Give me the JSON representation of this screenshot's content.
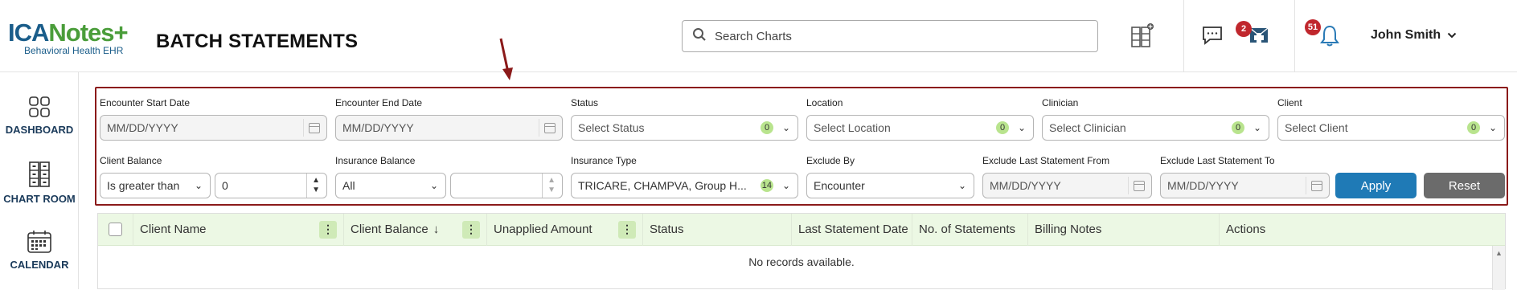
{
  "app": {
    "logo_main": "ICA",
    "logo_notes": "Notes",
    "logo_plus": "+",
    "logo_sub": "Behavioral Health EHR",
    "page_title": "BATCH STATEMENTS"
  },
  "header": {
    "search_placeholder": "Search Charts",
    "messages_badge": "2",
    "notifications_badge": "51",
    "user_name": "John Smith"
  },
  "sidebar": {
    "items": [
      {
        "label": "DASHBOARD",
        "icon": "dashboard-icon"
      },
      {
        "label": "CHART ROOM",
        "icon": "chart-room-icon"
      },
      {
        "label": "CALENDAR",
        "icon": "calendar-icon"
      }
    ]
  },
  "filters": {
    "encounter_start": {
      "label": "Encounter Start Date",
      "placeholder": "MM/DD/YYYY"
    },
    "encounter_end": {
      "label": "Encounter End Date",
      "placeholder": "MM/DD/YYYY"
    },
    "status": {
      "label": "Status",
      "placeholder": "Select Status",
      "count": "0"
    },
    "location": {
      "label": "Location",
      "placeholder": "Select Location",
      "count": "0"
    },
    "clinician": {
      "label": "Clinician",
      "placeholder": "Select Clinician",
      "count": "0"
    },
    "client": {
      "label": "Client",
      "placeholder": "Select Client",
      "count": "0"
    },
    "client_balance": {
      "label": "Client Balance",
      "operator": "Is greater than",
      "value": "0"
    },
    "insurance_balance": {
      "label": "Insurance Balance",
      "value": "All",
      "amount": ""
    },
    "insurance_type": {
      "label": "Insurance Type",
      "value": "TRICARE, CHAMPVA, Group H...",
      "count": "14"
    },
    "exclude_by": {
      "label": "Exclude By",
      "value": "Encounter"
    },
    "exclude_from": {
      "label": "Exclude Last Statement From",
      "placeholder": "MM/DD/YYYY"
    },
    "exclude_to": {
      "label": "Exclude Last Statement To",
      "placeholder": "MM/DD/YYYY"
    },
    "apply_label": "Apply",
    "reset_label": "Reset"
  },
  "grid": {
    "columns": [
      {
        "label": "Client Name"
      },
      {
        "label": "Client Balance",
        "sort": "↓"
      },
      {
        "label": "Unapplied Amount"
      },
      {
        "label": "Status"
      },
      {
        "label": "Last Statement Date"
      },
      {
        "label": "No. of Statements"
      },
      {
        "label": "Billing Notes"
      },
      {
        "label": "Actions"
      }
    ],
    "empty_text": "No records available."
  },
  "colors": {
    "brand_blue": "#1a5d8a",
    "brand_green": "#4a9d3a",
    "highlight_border": "#8b1a1a",
    "apply_button": "#1f7ab6",
    "reset_button": "#6b6b6b",
    "badge_red": "#c0272d",
    "count_green": "#b9e48e",
    "grid_header": "#ecf8e4"
  }
}
